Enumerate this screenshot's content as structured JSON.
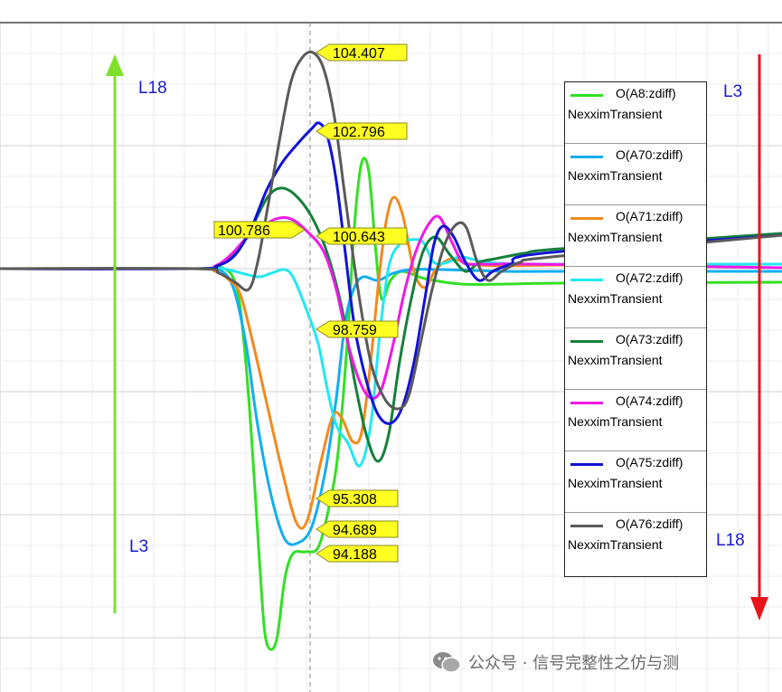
{
  "chart_data": {
    "type": "line",
    "series": [
      {
        "name": "O(A8:zdiff)",
        "sub": "NexximTransient",
        "color": "#33e024"
      },
      {
        "name": "O(A70:zdiff)",
        "sub": "NexximTransient",
        "color": "#12aef0"
      },
      {
        "name": "O(A71:zdiff)",
        "sub": "NexximTransient",
        "color": "#f28a1e"
      },
      {
        "name": "O(A72:zdiff)",
        "sub": "NexximTransient",
        "color": "#22e8f2"
      },
      {
        "name": "O(A73:zdiff)",
        "sub": "NexximTransient",
        "color": "#15803a"
      },
      {
        "name": "O(A74:zdiff)",
        "sub": "NexximTransient",
        "color": "#f018e6"
      },
      {
        "name": "O(A75:zdiff)",
        "sub": "NexximTransient",
        "color": "#1212d6"
      },
      {
        "name": "O(A76:zdiff)",
        "sub": "NexximTransient",
        "color": "#5a5a5a"
      }
    ],
    "data_labels": [
      "104.407",
      "102.796",
      "100.786",
      "100.643",
      "98.759",
      "95.308",
      "94.689",
      "94.188"
    ],
    "legend_position": "right",
    "grid": true
  },
  "annotations": {
    "left_arrow_top": "L18",
    "left_arrow_bottom": "L3",
    "right_arrow_top": "L3",
    "right_arrow_bottom": "L18",
    "left_arrow_color": "#7ee02a",
    "right_arrow_color": "#e8141c"
  },
  "watermark": "公众号 · 信号完整性之仿与测"
}
